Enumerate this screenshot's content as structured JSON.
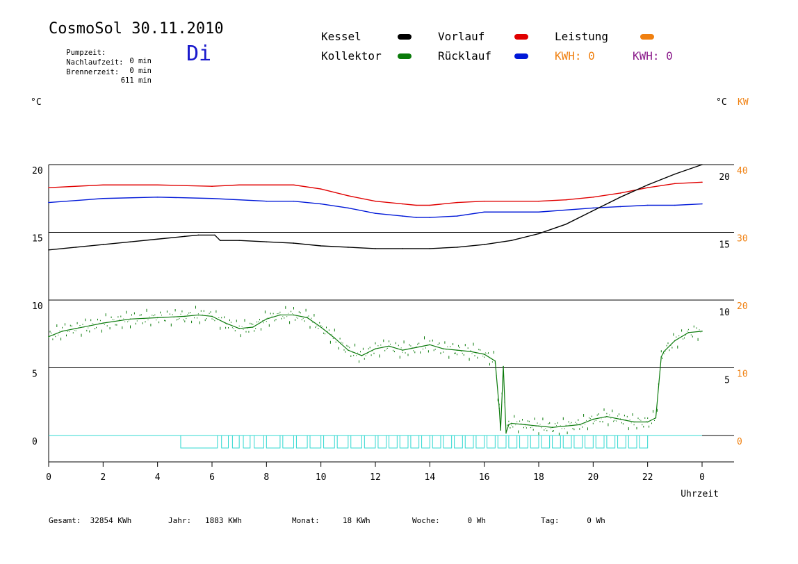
{
  "header": {
    "title": "CosmoSol 30.11.2010",
    "day": "Di",
    "stats": [
      {
        "label": "Pumpzeit:",
        "value": "0 min"
      },
      {
        "label": "Nachlaufzeit:",
        "value": "0 min"
      },
      {
        "label": "Brennerzeit:",
        "value": "611 min"
      }
    ]
  },
  "legend": {
    "kessel": "Kessel",
    "kollektor": "Kollektor",
    "vorlauf": "Vorlauf",
    "ruecklauf": "Rücklauf",
    "leistung": "Leistung",
    "kwh1": "KWH: 0",
    "kwh2": "KWH: 0"
  },
  "units": {
    "left": "°C",
    "right_c": "°C",
    "right_kw": "KW"
  },
  "footer": {
    "gesamt": "Gesamt:  32854 KWh",
    "jahr": "Jahr:   1883 KWh",
    "monat": "Monat:     18 KWh",
    "woche": "Woche:      0 Wh",
    "tag": "Tag:      0 Wh"
  },
  "colors": {
    "kessel": "#000000",
    "kollektor": "#0a7a0a",
    "vorlauf": "#e00000",
    "ruecklauf": "#0018d8",
    "leistung": "#f08010",
    "kwh2": "#8a1a8a",
    "pump": "#30d8d0",
    "day": "#1a1acc"
  },
  "chart_data": {
    "type": "line",
    "xlabel": "Uhrzeit",
    "xlim": [
      0,
      24
    ],
    "x_tick_labels": [
      "0",
      "2",
      "4",
      "6",
      "8",
      "10",
      "12",
      "14",
      "16",
      "18",
      "20",
      "22",
      "0"
    ],
    "ylim": [
      -1,
      25
    ],
    "y_tick_labels_left": [
      "0",
      "5",
      "10",
      "15",
      "20"
    ],
    "y_tick_labels_right_c": [
      "5",
      "10",
      "15",
      "20"
    ],
    "y_tick_labels_right_kw": [
      "0",
      "10",
      "20",
      "30",
      "40"
    ],
    "grid": "horizontal",
    "series": [
      {
        "name": "Vorlauf",
        "color": "#e00000",
        "x": [
          0,
          2,
          4,
          6,
          7,
          8,
          9,
          10,
          11,
          12,
          13,
          13.5,
          14,
          15,
          16,
          18,
          19,
          20,
          21,
          22,
          23,
          24
        ],
        "y": [
          18.3,
          18.5,
          18.5,
          18.4,
          18.5,
          18.5,
          18.5,
          18.2,
          17.7,
          17.3,
          17.1,
          17.0,
          17.0,
          17.2,
          17.3,
          17.3,
          17.4,
          17.6,
          17.9,
          18.3,
          18.6,
          18.7
        ]
      },
      {
        "name": "Rücklauf",
        "color": "#0018d8",
        "x": [
          0,
          2,
          4,
          6,
          8,
          9,
          10,
          11,
          12,
          13,
          13.5,
          14,
          15,
          16,
          18,
          20,
          21,
          22,
          23,
          24
        ],
        "y": [
          17.2,
          17.5,
          17.6,
          17.5,
          17.3,
          17.3,
          17.1,
          16.8,
          16.4,
          16.2,
          16.1,
          16.1,
          16.2,
          16.5,
          16.5,
          16.8,
          16.9,
          17.0,
          17.0,
          17.1
        ]
      },
      {
        "name": "Kessel",
        "color": "#000000",
        "x": [
          0,
          1,
          2,
          3,
          4,
          5,
          5.5,
          6.1,
          6.3,
          7,
          8,
          9,
          10,
          11,
          12,
          13,
          14,
          15,
          16,
          17,
          18,
          19,
          20,
          21,
          22,
          23,
          24
        ],
        "y": [
          13.7,
          13.9,
          14.1,
          14.3,
          14.5,
          14.7,
          14.8,
          14.8,
          14.4,
          14.4,
          14.3,
          14.2,
          14.0,
          13.9,
          13.8,
          13.8,
          13.8,
          13.9,
          14.1,
          14.4,
          14.9,
          15.6,
          16.6,
          17.6,
          18.5,
          19.3,
          20.0
        ]
      },
      {
        "name": "Kollektor",
        "color": "#0a7a0a",
        "x": [
          0,
          0.5,
          1,
          1.5,
          2,
          3,
          4,
          5,
          5.5,
          6,
          6.5,
          7,
          7.5,
          8,
          8.5,
          9,
          9.5,
          10,
          10.5,
          11,
          11.5,
          12,
          12.5,
          13,
          13.5,
          14,
          14.5,
          15,
          15.5,
          16,
          16.4,
          16.55,
          16.6,
          16.7,
          16.8,
          16.9,
          17,
          17.5,
          18,
          18.5,
          19,
          19.5,
          20,
          20.5,
          21,
          21.5,
          22,
          22.3,
          22.5,
          22.6,
          23,
          23.5,
          24
        ],
        "y": [
          7.3,
          7.7,
          7.9,
          8.1,
          8.3,
          8.6,
          8.7,
          8.8,
          8.9,
          8.8,
          8.3,
          7.9,
          8.0,
          8.6,
          8.9,
          8.9,
          8.7,
          8.0,
          7.2,
          6.3,
          5.9,
          6.4,
          6.6,
          6.3,
          6.5,
          6.7,
          6.4,
          6.3,
          6.2,
          6.0,
          5.5,
          2.0,
          0.4,
          5.1,
          0.2,
          0.8,
          0.9,
          0.8,
          0.7,
          0.6,
          0.7,
          0.8,
          1.2,
          1.4,
          1.2,
          1.0,
          1.0,
          1.3,
          5.8,
          6.2,
          7.0,
          7.6,
          7.7
        ]
      }
    ],
    "pump_blocks": {
      "name": "Pumpe",
      "color": "#30d8d0",
      "x": [
        [
          4.85,
          6.2
        ],
        [
          6.35,
          6.6
        ],
        [
          6.75,
          7.0
        ],
        [
          7.15,
          7.4
        ],
        [
          7.55,
          7.9
        ],
        [
          8.0,
          8.5
        ],
        [
          8.6,
          9.0
        ],
        [
          9.1,
          9.5
        ],
        [
          9.6,
          10.0
        ],
        [
          10.1,
          10.5
        ],
        [
          10.6,
          11.0
        ],
        [
          11.1,
          11.5
        ],
        [
          11.6,
          12.0
        ],
        [
          12.1,
          12.4
        ],
        [
          12.5,
          12.8
        ],
        [
          12.9,
          13.2
        ],
        [
          13.3,
          13.6
        ],
        [
          13.7,
          14.0
        ],
        [
          14.1,
          14.4
        ],
        [
          14.5,
          14.8
        ],
        [
          14.9,
          15.2
        ],
        [
          15.3,
          15.6
        ],
        [
          15.7,
          16.0
        ],
        [
          16.1,
          16.4
        ],
        [
          16.5,
          16.8
        ],
        [
          16.9,
          17.2
        ],
        [
          17.3,
          17.6
        ],
        [
          17.7,
          18.0
        ],
        [
          18.1,
          18.4
        ],
        [
          18.5,
          18.8
        ],
        [
          18.9,
          19.2
        ],
        [
          19.3,
          19.6
        ],
        [
          19.7,
          20.0
        ],
        [
          20.1,
          20.4
        ],
        [
          20.5,
          20.8
        ],
        [
          20.9,
          21.2
        ],
        [
          21.3,
          21.6
        ],
        [
          21.7,
          22.0
        ]
      ]
    }
  }
}
